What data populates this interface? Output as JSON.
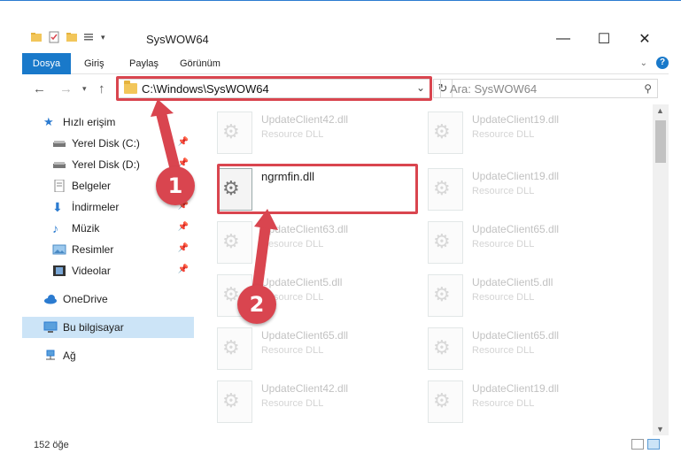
{
  "window": {
    "title": "SysWOW64",
    "minimize": "—",
    "maximize": "☐",
    "close": "✕"
  },
  "ribbon": {
    "tabs": [
      "Dosya",
      "Giriş",
      "Paylaş",
      "Görünüm"
    ],
    "expand_icon": "chevron-down-icon",
    "help": "?"
  },
  "address": {
    "path": "C:\\Windows\\SysWOW64",
    "search_placeholder": "Ara: SysWOW64"
  },
  "sidebar": {
    "items": [
      {
        "label": "Hızlı erişim",
        "icon": "star-icon"
      },
      {
        "label": "Yerel Disk (C:)",
        "icon": "drive-icon",
        "pinned": true
      },
      {
        "label": "Yerel Disk (D:)",
        "icon": "drive-icon",
        "pinned": true
      },
      {
        "label": "Belgeler",
        "icon": "document-icon",
        "pinned": true
      },
      {
        "label": "İndirmeler",
        "icon": "download-icon",
        "pinned": true
      },
      {
        "label": "Müzik",
        "icon": "music-icon",
        "pinned": true
      },
      {
        "label": "Resimler",
        "icon": "pictures-icon",
        "pinned": true
      },
      {
        "label": "Videolar",
        "icon": "video-icon",
        "pinned": true
      },
      {
        "label": "OneDrive",
        "icon": "cloud-icon"
      },
      {
        "label": "Bu bilgisayar",
        "icon": "computer-icon",
        "selected": true
      },
      {
        "label": "Ağ",
        "icon": "network-icon"
      }
    ]
  },
  "files": {
    "left": [
      {
        "name": "UpdateClient42.dll",
        "desc": "Resource DLL"
      },
      {
        "name": "ngrmfin.dll",
        "desc": "",
        "active": true
      },
      {
        "name": "UpdateClient63.dll",
        "desc": "Resource DLL"
      },
      {
        "name": "UpdateClient5.dll",
        "desc": "Resource DLL"
      },
      {
        "name": "UpdateClient65.dll",
        "desc": "Resource DLL"
      },
      {
        "name": "UpdateClient42.dll",
        "desc": "Resource DLL"
      }
    ],
    "right": [
      {
        "name": "UpdateClient19.dll",
        "desc": "Resource DLL"
      },
      {
        "name": "UpdateClient19.dll",
        "desc": "Resource DLL"
      },
      {
        "name": "UpdateClient65.dll",
        "desc": "Resource DLL"
      },
      {
        "name": "UpdateClient5.dll",
        "desc": "Resource DLL"
      },
      {
        "name": "UpdateClient65.dll",
        "desc": "Resource DLL"
      },
      {
        "name": "UpdateClient19.dll",
        "desc": "Resource DLL"
      }
    ]
  },
  "status": {
    "count": "152 öğe"
  },
  "annotations": {
    "step1": "1",
    "step2": "2",
    "color": "#d9454f"
  }
}
